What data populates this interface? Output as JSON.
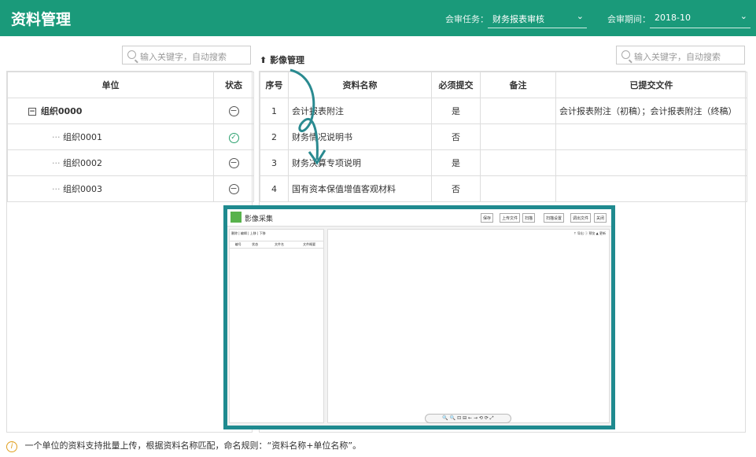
{
  "header": {
    "title": "资料管理",
    "task_label": "会审任务：",
    "task_value": "财务报表审核",
    "period_label": "会审期间：",
    "period_value": "2018-10"
  },
  "left_search": {
    "placeholder": "输入关键字，自动搜索"
  },
  "right_search": {
    "placeholder": "输入关键字，自动搜索"
  },
  "image_manage_label": "影像管理",
  "tree": {
    "headers": [
      "单位",
      "状态"
    ],
    "rows": [
      {
        "name": "组织0000",
        "status": "none",
        "level": 0
      },
      {
        "name": "组织0001",
        "status": "ok",
        "level": 1
      },
      {
        "name": "组织0002",
        "status": "none",
        "level": 1
      },
      {
        "name": "组织0003",
        "status": "none",
        "level": 1
      }
    ]
  },
  "docs": {
    "headers": [
      "序号",
      "资料名称",
      "必须提交",
      "备注",
      "已提交文件"
    ],
    "rows": [
      {
        "no": "1",
        "name": "会计报表附注",
        "required": "是",
        "note": "",
        "files": "会计报表附注（初稿）；会计报表附注（终稿）"
      },
      {
        "no": "2",
        "name": "财务情况说明书",
        "required": "否",
        "note": "",
        "files": ""
      },
      {
        "no": "3",
        "name": "财务决算专项说明",
        "required": "是",
        "note": "",
        "files": ""
      },
      {
        "no": "4",
        "name": "国有资本保值增值客观材料",
        "required": "否",
        "note": "",
        "files": ""
      }
    ]
  },
  "viewer": {
    "title": "影像采集",
    "buttons": [
      "保存",
      "上传文件",
      "扫描",
      "扫描设置",
      "调出文件",
      "关闭"
    ],
    "left_toolbar": "删除 | 编辑 | 上移 | 下移",
    "left_columns": [
      "编号",
      "状态",
      "文件名",
      "文件概要"
    ],
    "right_links": "↑ 导出 ⓘ 预览 ▲ 更新",
    "zoom_tools": "🔍 🔍 ⊡ ⊟ ← → ⟲ ⟳ ⤢"
  },
  "note": "一个单位的资料支持批量上传，根据资料名称匹配，命名规则：“资料名称+单位名称”。",
  "colors": {
    "header": "#1a9a7a",
    "viewer_border": "#1f8a8f",
    "ok": "#2aa06e"
  }
}
